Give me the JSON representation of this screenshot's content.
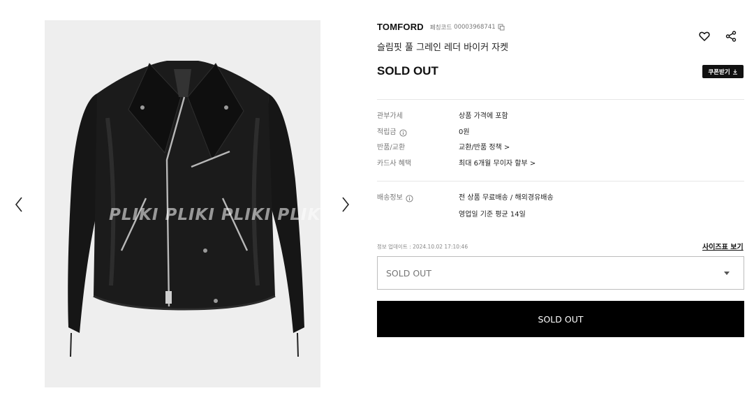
{
  "gallery": {
    "prev_icon": "chevron-left-icon",
    "next_icon": "chevron-right-icon",
    "watermark": "PLIKI  PLIKI  PLIKI  PLIKI",
    "background": "#eeeeee"
  },
  "product": {
    "brand": "TOMFORD",
    "code_label": "페칭코드",
    "code_value": "00003968741",
    "name": "슬림핏 풀 그레인 레더 바이커 자켓",
    "status": "SOLD OUT",
    "coupon_label": "쿠폰받기"
  },
  "details": [
    {
      "label": "관부가세",
      "value": "상품 가격에 포함",
      "has_info": false
    },
    {
      "label": "적립금",
      "value": "0원",
      "has_info": true
    },
    {
      "label": "반품/교환",
      "value": "교환/반품 정책 >",
      "has_info": false
    },
    {
      "label": "카드사 혜택",
      "value": "최대 6개월 무이자 할부 >",
      "has_info": false
    }
  ],
  "shipping": {
    "label": "배송정보",
    "line1": "전 상품 무료배송 / 해외경유배송",
    "line2": "영업일 기준 평균 14일"
  },
  "updated": "정보 업데이트 : 2024.10.02 17:10:46",
  "size_chart_label": "사이즈표 보기",
  "option_select": {
    "value": "SOLD OUT"
  },
  "buy_button_label": "SOLD OUT",
  "colors": {
    "accent": "#000000",
    "text_muted": "#777777",
    "divider": "#e6e6e6"
  }
}
